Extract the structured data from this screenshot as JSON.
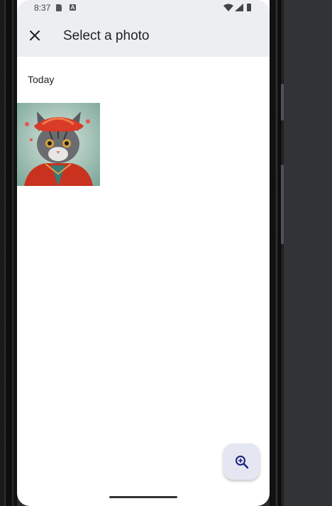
{
  "status_bar": {
    "time": "8:37",
    "icons": [
      "sd-card-icon",
      "a-app-icon",
      "wifi-icon",
      "signal-icon",
      "battery-icon"
    ]
  },
  "app_bar": {
    "close_icon": "close-icon",
    "title": "Select a photo"
  },
  "gallery": {
    "section_header": "Today",
    "photos": [
      {
        "description_icon": "cat-photo"
      }
    ]
  },
  "fab": {
    "icon": "zoom-in-icon"
  },
  "colors": {
    "app_bar_bg": "#eceef2",
    "screen_bg": "#ffffff",
    "fab_bg": "#e4e6f2",
    "accent": "#1a237e"
  }
}
